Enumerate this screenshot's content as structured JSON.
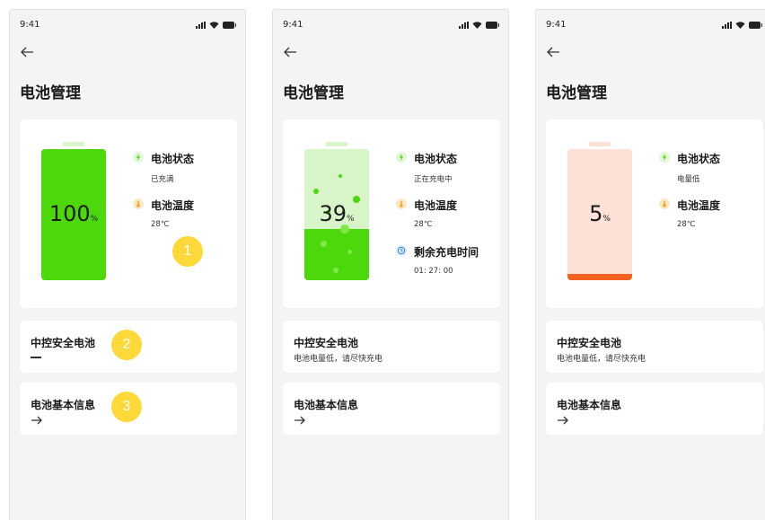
{
  "screens": [
    {
      "status_time": "9:41",
      "title": "电池管理",
      "battery": {
        "percent": 100,
        "percent_text": "100",
        "unit": "%",
        "color": "#4cd80a"
      },
      "info": {
        "status_label": "电池状态",
        "status_value": "已充满",
        "temp_label": "电池温度",
        "temp_value": "28℃"
      },
      "card2": {
        "title": "中控安全电池",
        "value": "—"
      },
      "card3": {
        "title": "电池基本信息"
      },
      "badges": [
        "1",
        "2",
        "3"
      ]
    },
    {
      "status_time": "9:41",
      "title": "电池管理",
      "battery": {
        "percent": 39,
        "percent_text": "39",
        "unit": "%",
        "color": "#4cd80a"
      },
      "info": {
        "status_label": "电池状态",
        "status_value": "正在充电中",
        "temp_label": "电池温度",
        "temp_value": "28℃",
        "remain_label": "剩余充电时间",
        "remain_value": "01: 27: 00"
      },
      "card2": {
        "title": "中控安全电池",
        "subtitle": "电池电量低，请尽快充电"
      },
      "card3": {
        "title": "电池基本信息"
      }
    },
    {
      "status_time": "9:41",
      "title": "电池管理",
      "battery": {
        "percent": 5,
        "percent_text": "5",
        "unit": "%",
        "color": "#f2621e"
      },
      "info": {
        "status_label": "电池状态",
        "status_value": "电量低",
        "temp_label": "电池温度",
        "temp_value": "28℃"
      },
      "card2": {
        "title": "中控安全电池",
        "subtitle": "电池电量低，请尽快充电"
      },
      "card3": {
        "title": "电池基本信息"
      }
    }
  ],
  "icons": [
    "back-arrow-icon",
    "signal-icon",
    "wifi-icon",
    "battery-status-icon",
    "lightning-icon",
    "thermometer-icon",
    "clock-icon",
    "right-arrow-icon"
  ],
  "colors": {
    "green": "#4cd80a",
    "light_green": "#d7f5c8",
    "orange": "#f2621e",
    "light_pink": "#fde0d6",
    "badge": "#ffd83a",
    "background": "#f4f4f4"
  }
}
